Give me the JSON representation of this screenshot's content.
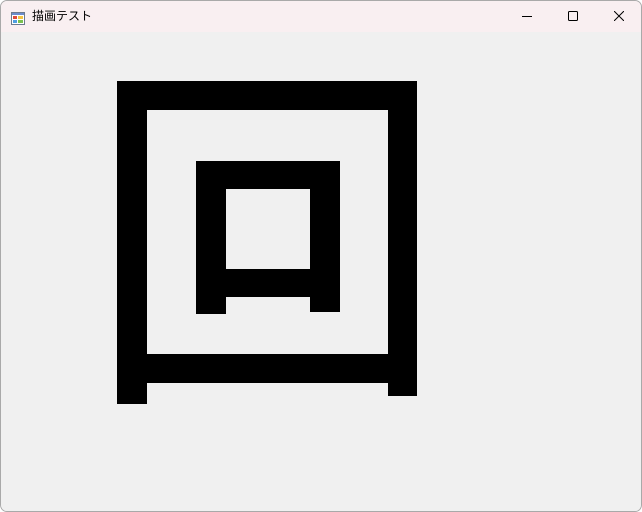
{
  "window": {
    "title": "描画テスト",
    "title_bar_color": "#f9eff1",
    "client_background": "#f0f0f0"
  },
  "title_bar": {
    "app_icon": "form-app-icon",
    "buttons": [
      {
        "name": "minimize",
        "icon": "minimize-icon"
      },
      {
        "name": "maximize",
        "icon": "maximize-icon"
      },
      {
        "name": "close",
        "icon": "close-icon"
      }
    ]
  },
  "drawing": {
    "description_shapes": [
      "outer-square-frame",
      "inner-square-frame"
    ],
    "fill_color": "#000000"
  }
}
